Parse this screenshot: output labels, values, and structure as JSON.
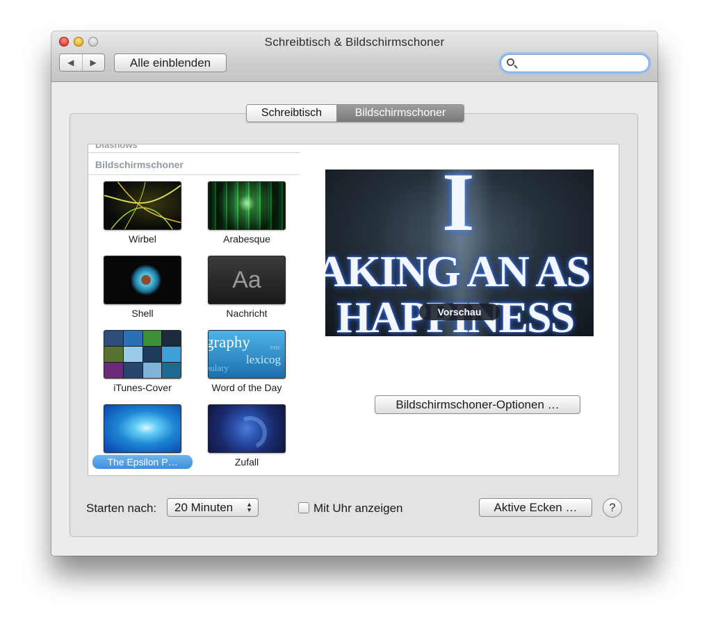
{
  "window": {
    "title": "Schreibtisch & Bildschirmschoner"
  },
  "toolbar": {
    "back_glyph": "◀",
    "forward_glyph": "▶",
    "show_all_label": "Alle einblenden",
    "search": {
      "value": "",
      "placeholder": ""
    }
  },
  "tabs": [
    {
      "label": "Schreibtisch",
      "selected": false
    },
    {
      "label": "Bildschirmschoner",
      "selected": true
    }
  ],
  "list": {
    "cut_header": "Diashows",
    "section_header": "Bildschirmschoner",
    "items": [
      {
        "label": "Wirbel",
        "icon": "wirbel-thumbnail"
      },
      {
        "label": "Arabesque",
        "icon": "arabesque-thumbnail"
      },
      {
        "label": "Shell",
        "icon": "shell-thumbnail"
      },
      {
        "label": "Nachricht",
        "icon": "nachricht-thumbnail",
        "thumb_text": "Aa"
      },
      {
        "label": "iTunes-Cover",
        "icon": "itunes-cover-thumbnail"
      },
      {
        "label": "Word of the Day",
        "icon": "word-of-the-day-thumbnail",
        "thumb_words": [
          "graphy",
          "lexicog",
          "abulary",
          "voc"
        ]
      },
      {
        "label": "The Epsilon P…",
        "icon": "epsilon-thumbnail",
        "selected": true
      },
      {
        "label": "Zufall",
        "icon": "zufall-thumbnail"
      }
    ]
  },
  "preview": {
    "big_letter": "I",
    "line1": "AKING AN AS",
    "line2": "HAPPINESS",
    "badge": "Vorschau",
    "options_button": "Bildschirmschoner-Optionen …"
  },
  "footer": {
    "start_label": "Starten nach:",
    "start_value": "20 Minuten",
    "clock_label": "Mit Uhr anzeigen",
    "clock_checked": false,
    "hot_corners_button": "Aktive Ecken …",
    "help_glyph": "?"
  },
  "colors": {
    "selection": "#3d8fdc",
    "search_focus": "#9cc1ee"
  }
}
